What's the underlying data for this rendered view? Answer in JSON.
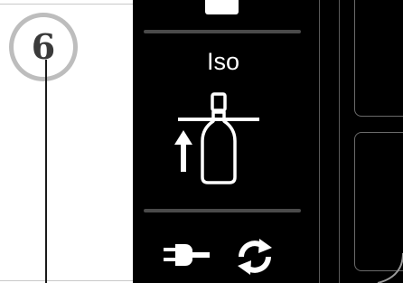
{
  "step": {
    "number": "6"
  },
  "screen": {
    "mode_label": "Iso",
    "icons": {
      "main": "bottle-with-up-arrow-icon",
      "power": "plug-icon",
      "refresh": "refresh-icon"
    }
  },
  "colors": {
    "screen_bg": "#000000",
    "screen_text": "#ffffff",
    "divider": "#4a4a4a",
    "badge_ring": "#bdbdbd",
    "badge_text": "#3a3a3a"
  }
}
